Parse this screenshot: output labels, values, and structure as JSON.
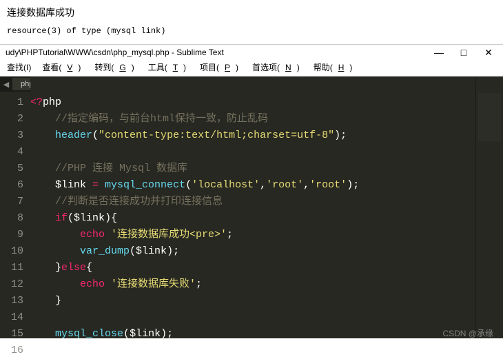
{
  "browser_output": {
    "line1": "连接数据库成功",
    "line2": "resource(3) of type (mysql link)"
  },
  "window": {
    "title": "udy\\PHPTutorial\\WWW\\csdn\\php_mysql.php - Sublime Text",
    "minimize": "—",
    "maximize": "□",
    "close": "✕"
  },
  "menu": {
    "find": "查找(I)",
    "view": "查看(",
    "view_u": "V",
    "view_end": ")",
    "goto": "转到(",
    "goto_u": "G",
    "goto_end": ")",
    "tools": "工具(",
    "tools_u": "T",
    "tools_end": ")",
    "project": "项目(",
    "project_u": "P",
    "project_end": ")",
    "prefs": "首选项(",
    "prefs_u": "N",
    "prefs_end": ")",
    "help": "帮助(",
    "help_u": "H",
    "help_end": ")"
  },
  "tab": {
    "arrow": "◀",
    "name": "php_mysql.php"
  },
  "gutter": [
    "1",
    "2",
    "3",
    "4",
    "5",
    "6",
    "7",
    "8",
    "9",
    "10",
    "11",
    "12",
    "13",
    "14",
    "15",
    "16"
  ],
  "code": {
    "l1_open": "<?",
    "l1_php": "php",
    "l2_cmt": "//指定编码，与前台html保持一致，防止乱码",
    "l3_fn": "header",
    "l3_p1": "(",
    "l3_str": "\"content-type:text/html;charset=utf-8\"",
    "l3_p2": ");",
    "l5_cmt": "//PHP 连接 Mysql 数据库",
    "l6_var": "$link",
    "l6_eq": " = ",
    "l6_fn": "mysql_connect",
    "l6_p1": "(",
    "l6_s1": "'localhost'",
    "l6_c1": ",",
    "l6_s2": "'root'",
    "l6_c2": ",",
    "l6_s3": "'root'",
    "l6_p2": ");",
    "l7_cmt": "//判断是否连接成功并打印连接信息",
    "l8_if": "if",
    "l8_p1": "(",
    "l8_var": "$link",
    "l8_p2": "){",
    "l9_echo": "echo",
    "l9_str": " '连接数据库成功<pre>'",
    "l9_end": ";",
    "l10_fn": "var_dump",
    "l10_p1": "(",
    "l10_var": "$link",
    "l10_p2": ");",
    "l11": "}",
    "l11_else": "else",
    "l11_b": "{",
    "l12_echo": "echo",
    "l12_str": " '连接数据库失败'",
    "l12_end": ";",
    "l13": "}",
    "l15_fn": "mysql_close",
    "l15_p1": "(",
    "l15_var": "$link",
    "l15_p2": ");"
  },
  "watermark": "CSDN @承缘"
}
